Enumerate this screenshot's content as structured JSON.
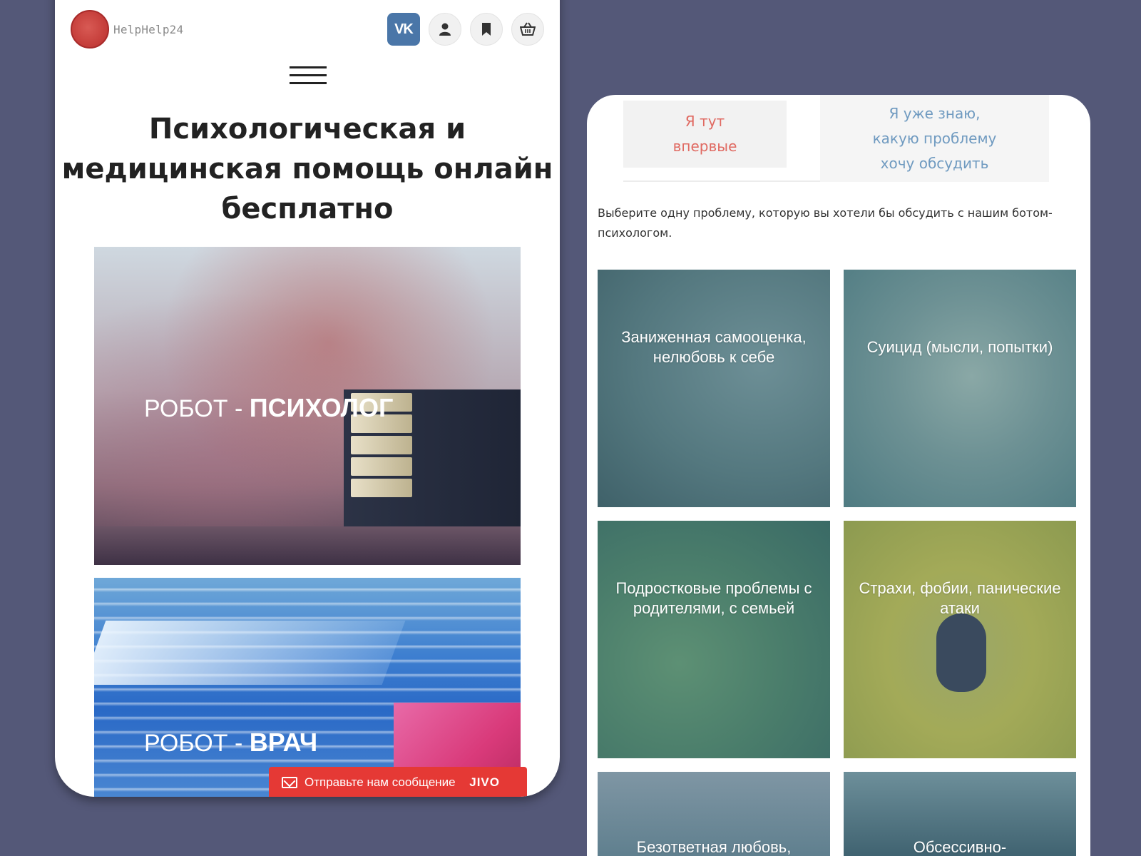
{
  "left_screen": {
    "logo_text": "HelpHelp24",
    "top_icons": [
      "vk-icon",
      "user-icon",
      "bookmark-icon",
      "basket-icon"
    ],
    "vk_label": "VK",
    "headline": "Психологическая и медицинская помощь онлайн бесплатно",
    "banners": [
      {
        "prefix": "РОБОТ - ",
        "name": "ПСИХОЛОГ"
      },
      {
        "prefix": "РОБОТ - ",
        "name": "ВРАЧ"
      }
    ],
    "chat_widget": {
      "label": "Отправьте нам сообщение",
      "brand": "JIVO"
    }
  },
  "right_screen": {
    "tabs": [
      {
        "label": "Я тут впервые"
      },
      {
        "label": "Я уже знаю, какую проблему хочу обсудить"
      }
    ],
    "intro": "Выберите одну проблему, которую вы хотели бы обсудить с нашим ботом-психологом.",
    "tiles": [
      {
        "label": "Заниженная самооценка, нелюбовь к себе"
      },
      {
        "label": "Суицид (мысли, попытки)"
      },
      {
        "label": "Подростковые проблемы с родителями, с семьей"
      },
      {
        "label": "Страхи, фобии, панические атаки"
      },
      {
        "label": "Безответная любовь,"
      },
      {
        "label": "Обсессивно-"
      }
    ]
  },
  "colors": {
    "background": "#545878",
    "vk": "#4a76a8",
    "chat": "#e53935",
    "tab_first_text": "#e06a62",
    "tab_second_text": "#6f9ac0"
  }
}
